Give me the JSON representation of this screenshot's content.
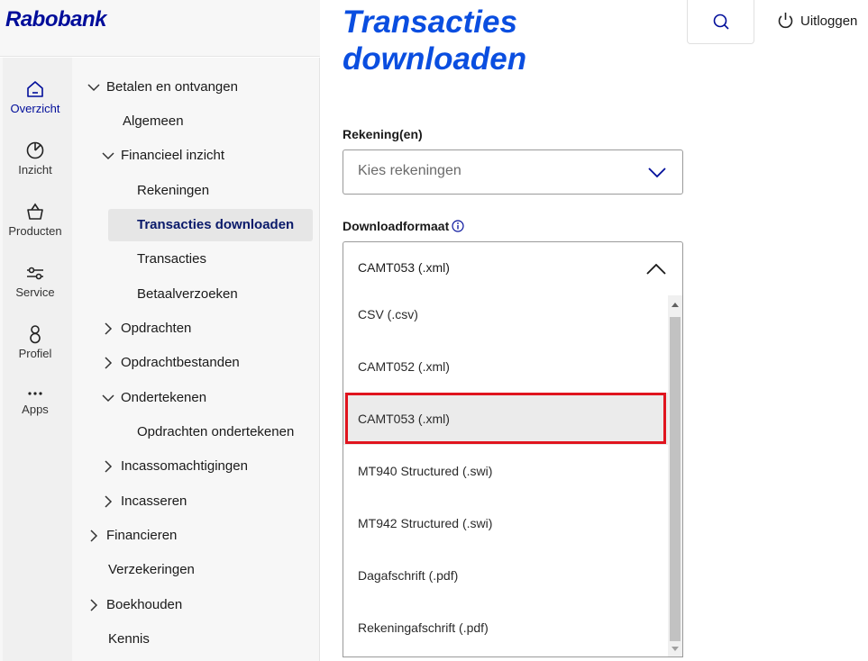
{
  "brand": {
    "logo": "Rabobank",
    "accent": "#000d9a",
    "title_color": "#0a4ee0",
    "highlight": "#e0141e"
  },
  "rail": [
    {
      "label": "Overzicht",
      "icon": "home-icon",
      "active": true
    },
    {
      "label": "Inzicht",
      "icon": "pie-chart-icon",
      "active": false
    },
    {
      "label": "Producten",
      "icon": "basket-icon",
      "active": false
    },
    {
      "label": "Service",
      "icon": "sliders-icon",
      "active": false
    },
    {
      "label": "Profiel",
      "icon": "user-icon",
      "active": false
    },
    {
      "label": "Apps",
      "icon": "more-dots-icon",
      "active": false
    }
  ],
  "subnav": [
    {
      "label": "Betalen en ontvangen",
      "chevron": "down"
    },
    {
      "label": "Algemeen",
      "chevron": "none"
    },
    {
      "label": "Financieel inzicht",
      "chevron": "down"
    },
    {
      "label": "Rekeningen",
      "chevron": "none"
    },
    {
      "label": "Transacties downloaden",
      "chevron": "none",
      "active": true
    },
    {
      "label": "Transacties",
      "chevron": "none"
    },
    {
      "label": "Betaalverzoeken",
      "chevron": "none"
    },
    {
      "label": "Opdrachten",
      "chevron": "right"
    },
    {
      "label": "Opdrachtbestanden",
      "chevron": "right"
    },
    {
      "label": "Ondertekenen",
      "chevron": "down"
    },
    {
      "label": "Opdrachten ondertekenen",
      "chevron": "none"
    },
    {
      "label": "Incassomachtigingen",
      "chevron": "right"
    },
    {
      "label": "Incasseren",
      "chevron": "right"
    },
    {
      "label": "Financieren",
      "chevron": "right"
    },
    {
      "label": "Verzekeringen",
      "chevron": "none"
    },
    {
      "label": "Boekhouden",
      "chevron": "right"
    },
    {
      "label": "Kennis",
      "chevron": "none"
    }
  ],
  "header": {
    "search_icon": "search-icon",
    "logout_label": "Uitloggen",
    "logout_icon": "power-icon"
  },
  "main": {
    "title_line1": "Transacties",
    "title_line2": "downloaden",
    "accounts": {
      "label": "Rekening(en)",
      "placeholder": "Kies rekeningen"
    },
    "format": {
      "label": "Downloadformaat",
      "selected": "CAMT053 (.xml)",
      "options": [
        "CSV (.csv)",
        "CAMT052 (.xml)",
        "CAMT053 (.xml)",
        "MT940 Structured (.swi)",
        "MT942 Structured (.swi)",
        "Dagafschrift (.pdf)",
        "Rekeningafschrift (.pdf)"
      ],
      "selected_index": 2
    }
  }
}
